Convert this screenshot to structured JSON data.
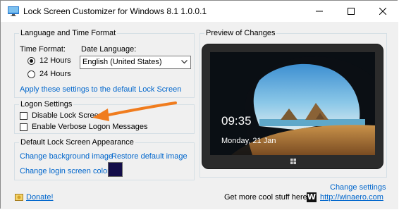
{
  "window": {
    "title": "Lock Screen Customizer for Windows 8.1 1.0.0.1"
  },
  "language_time": {
    "legend": "Language and Time Format",
    "time_format_label": "Time Format:",
    "option_12": "12 Hours",
    "option_24": "24 Hours",
    "selected_time_format": "12 Hours",
    "date_language_label": "Date Language:",
    "date_language_value": "English (United States)",
    "apply_link": "Apply these settings to the default Lock Screen"
  },
  "logon": {
    "legend": "Logon Settings",
    "disable_lock": "Disable Lock Screen",
    "verbose": "Enable Verbose Logon Messages",
    "disable_lock_checked": false,
    "verbose_checked": false
  },
  "appearance": {
    "legend": "Default Lock Screen Appearance",
    "change_bg": "Change background image",
    "restore": "Restore default image",
    "change_login_color": "Change login screen color",
    "login_color": "#130d49"
  },
  "preview": {
    "legend": "Preview of Changes",
    "time": "09:35",
    "date": "Monday, 21 Jan"
  },
  "footer": {
    "change_settings": "Change settings",
    "donate": "Donate!",
    "more_text": "Get more cool stuff here:",
    "winaero_logo": "W",
    "winaero_link": "http://winaero.com"
  },
  "colors": {
    "accent_arrow": "#f07c1e",
    "link": "#0066cc"
  }
}
